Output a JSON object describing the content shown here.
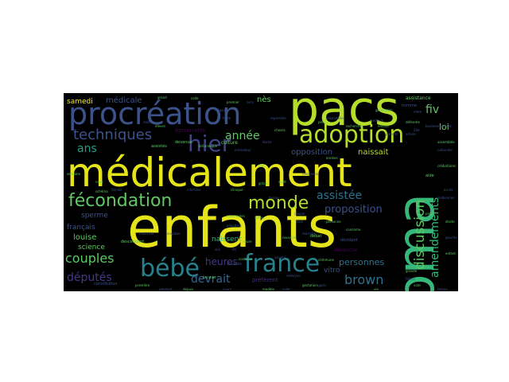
{
  "words": [
    {
      "text": "enfants",
      "weight": 1.0,
      "color": "#e5e419"
    },
    {
      "text": "médicalement",
      "weight": 0.9,
      "color": "#e5e419"
    },
    {
      "text": "pacs",
      "weight": 0.78,
      "color": "#b5de2b"
    },
    {
      "text": "pma",
      "weight": 0.78,
      "color": "#35b779"
    },
    {
      "text": "procréation",
      "weight": 0.55,
      "color": "#3b528b"
    },
    {
      "text": "adoption",
      "weight": 0.42,
      "color": "#b5de2b"
    },
    {
      "text": "france",
      "weight": 0.42,
      "color": "#26828e"
    },
    {
      "text": "bébé",
      "weight": 0.42,
      "color": "#26828e"
    },
    {
      "text": "fécondation",
      "weight": 0.34,
      "color": "#5ec962"
    },
    {
      "text": "monde",
      "weight": 0.34,
      "color": "#b5de2b"
    },
    {
      "text": "hier",
      "weight": 0.4,
      "color": "#414487"
    },
    {
      "text": "techniques",
      "weight": 0.3,
      "color": "#3b528b"
    },
    {
      "text": "discussion",
      "weight": 0.28,
      "color": "#5ec962"
    },
    {
      "text": "amendements",
      "weight": 0.22,
      "color": "#35b779"
    },
    {
      "text": "couples",
      "weight": 0.24,
      "color": "#5ec962"
    },
    {
      "text": "brown",
      "weight": 0.24,
      "color": "#2c728e"
    },
    {
      "text": "devrait",
      "weight": 0.22,
      "color": "#31688e"
    },
    {
      "text": "députés",
      "weight": 0.22,
      "color": "#443983"
    },
    {
      "text": "assistée",
      "weight": 0.22,
      "color": "#2c728e"
    },
    {
      "text": "proposition",
      "weight": 0.2,
      "color": "#3b528b"
    },
    {
      "text": "année",
      "weight": 0.2,
      "color": "#5ec962"
    },
    {
      "text": "ans",
      "weight": 0.2,
      "color": "#1f9e89"
    },
    {
      "text": "fiv",
      "weight": 0.2,
      "color": "#5ec962"
    },
    {
      "text": "heures",
      "weight": 0.18,
      "color": "#443983"
    },
    {
      "text": "loi",
      "weight": 0.14,
      "color": "#6ece58"
    },
    {
      "text": "personnes",
      "weight": 0.14,
      "color": "#2c728e"
    },
    {
      "text": "naissait",
      "weight": 0.13,
      "color": "#b5de2b"
    },
    {
      "text": "opposition",
      "weight": 0.13,
      "color": "#3b528b"
    },
    {
      "text": "médicale",
      "weight": 0.13,
      "color": "#3b528b"
    },
    {
      "text": "samedi",
      "weight": 0.12,
      "color": "#fde725"
    },
    {
      "text": "nès",
      "weight": 0.14,
      "color": "#5ec962"
    },
    {
      "text": "louise",
      "weight": 0.13,
      "color": "#5ec962"
    },
    {
      "text": "français",
      "weight": 0.12,
      "color": "#3b528b"
    },
    {
      "text": "science",
      "weight": 0.11,
      "color": "#5ec962"
    },
    {
      "text": "sperme",
      "weight": 0.11,
      "color": "#3b528b"
    },
    {
      "text": "naissent",
      "weight": 0.11,
      "color": "#35b779"
    },
    {
      "text": "vitro",
      "weight": 0.11,
      "color": "#3b528b"
    },
    {
      "text": "éprouvette",
      "weight": 0.08,
      "color": "#440154"
    },
    {
      "text": "préfèrent",
      "weight": 0.08,
      "color": "#472d7b"
    },
    {
      "text": "culture",
      "weight": 0.06,
      "color": "#5ec962"
    },
    {
      "text": "assistance",
      "weight": 0.06,
      "color": "#5ec962"
    },
    {
      "text": "dimanche",
      "weight": 0.06,
      "color": "#440154"
    },
    {
      "text": "décidant",
      "weight": 0.05,
      "color": "#3b528b"
    },
    {
      "text": "descendant",
      "weight": 0.05,
      "color": "#5ec962"
    },
    {
      "text": "inscrire",
      "weight": 0.05,
      "color": "#3b528b"
    },
    {
      "text": "devenue",
      "weight": 0.05,
      "color": "#5ec962"
    },
    {
      "text": "constitution",
      "weight": 0.04,
      "color": "#3b528b"
    },
    {
      "text": "aide",
      "weight": 0.05,
      "color": "#5ec962"
    },
    {
      "text": "débat",
      "weight": 0.04,
      "color": "#5ec962"
    },
    {
      "text": "homme",
      "weight": 0.04,
      "color": "#3b528b"
    },
    {
      "text": "grande",
      "weight": 0.04,
      "color": "#5ec962"
    },
    {
      "text": "grand",
      "weight": 0.04,
      "color": "#5ec962"
    },
    {
      "text": "continue",
      "weight": 0.04,
      "color": "#5ec962"
    },
    {
      "text": "fin",
      "weight": 0.04,
      "color": "#3b528b"
    },
    {
      "text": "concernées",
      "weight": 0.04,
      "color": "#5ec962"
    },
    {
      "text": "demandé",
      "weight": 0.04,
      "color": "#3b528b"
    },
    {
      "text": "assistés",
      "weight": 0.05,
      "color": "#5ec962"
    },
    {
      "text": "article",
      "weight": 0.04,
      "color": "#3b528b"
    },
    {
      "text": "défendre",
      "weight": 0.04,
      "color": "#5ec962"
    },
    {
      "text": "appris",
      "weight": 0.04,
      "color": "#3b528b"
    },
    {
      "text": "génération",
      "weight": 0.04,
      "color": "#5ec962"
    },
    {
      "text": "bouleversement",
      "weight": 0.04,
      "color": "#3b528b"
    },
    {
      "text": "concerne",
      "weight": 0.04,
      "color": "#5ec962"
    },
    {
      "text": "baisse",
      "weight": 0.04,
      "color": "#3b528b"
    },
    {
      "text": "heure",
      "weight": 0.04,
      "color": "#5ec962"
    },
    {
      "text": "fabius",
      "weight": 0.03,
      "color": "#3b528b"
    },
    {
      "text": "choses",
      "weight": 0.03,
      "color": "#5ec962"
    },
    {
      "text": "rapport",
      "weight": 0.03,
      "color": "#3b528b"
    },
    {
      "text": "600",
      "weight": 0.03,
      "color": "#5ec962"
    },
    {
      "text": "20e",
      "weight": 0.03,
      "color": "#3b528b"
    },
    {
      "text": "personne",
      "weight": 0.03,
      "color": "#5ec962"
    },
    {
      "text": "couple",
      "weight": 0.03,
      "color": "#3b528b"
    },
    {
      "text": "auteur",
      "weight": 0.03,
      "color": "#5ec962"
    },
    {
      "text": "société",
      "weight": 0.03,
      "color": "#3b528b"
    },
    {
      "text": "projet",
      "weight": 0.03,
      "color": "#5ec962"
    },
    {
      "text": "loin",
      "weight": 0.03,
      "color": "#3b528b"
    },
    {
      "text": "grâce",
      "weight": 0.03,
      "color": "#5ec962"
    },
    {
      "text": "droit",
      "weight": 0.03,
      "color": "#3b528b"
    },
    {
      "text": "commune",
      "weight": 0.03,
      "color": "#5ec962"
    },
    {
      "text": "anglaise",
      "weight": 0.03,
      "color": "#3b528b"
    },
    {
      "text": "clinique",
      "weight": 0.03,
      "color": "#5ec962"
    },
    {
      "text": "reprendre",
      "weight": 0.03,
      "color": "#3b528b"
    },
    {
      "text": "schéma",
      "weight": 0.03,
      "color": "#5ec962"
    },
    {
      "text": "famille",
      "weight": 0.03,
      "color": "#3b528b"
    },
    {
      "text": "ceux",
      "weight": 0.03,
      "color": "#5ec962"
    },
    {
      "text": "texte",
      "weight": 0.03,
      "color": "#3b528b"
    },
    {
      "text": "celle",
      "weight": 0.03,
      "color": "#5ec962"
    },
    {
      "text": "sera",
      "weight": 0.03,
      "color": "#3b528b"
    },
    {
      "text": "premier",
      "weight": 0.03,
      "color": "#5ec962"
    },
    {
      "text": "matin",
      "weight": 0.03,
      "color": "#3b528b"
    },
    {
      "text": "élèves",
      "weight": 0.03,
      "color": "#5ec962"
    },
    {
      "text": "durée",
      "weight": 0.03,
      "color": "#3b528b"
    },
    {
      "text": "sujet",
      "weight": 0.03,
      "color": "#5ec962"
    },
    {
      "text": "mariage",
      "weight": 0.03,
      "color": "#3b528b"
    },
    {
      "text": "nouvelle",
      "weight": 0.03,
      "color": "#5ec962"
    },
    {
      "text": "président",
      "weight": 0.03,
      "color": "#3b528b"
    },
    {
      "text": "vote",
      "weight": 0.03,
      "color": "#5ec962"
    },
    {
      "text": "mère",
      "weight": 0.03,
      "color": "#3b528b"
    },
    {
      "text": "père",
      "weight": 0.03,
      "color": "#5ec962"
    },
    {
      "text": "laboratoire",
      "weight": 0.03,
      "color": "#3b528b"
    },
    {
      "text": "recherche",
      "weight": 0.03,
      "color": "#5ec962"
    },
    {
      "text": "médecin",
      "weight": 0.03,
      "color": "#3b528b"
    },
    {
      "text": "encore",
      "weight": 0.03,
      "color": "#5ec962"
    },
    {
      "text": "parents",
      "weight": 0.03,
      "color": "#3b528b"
    },
    {
      "text": "années",
      "weight": 0.03,
      "color": "#5ec962"
    },
    {
      "text": "naissance",
      "weight": 0.03,
      "color": "#3b528b"
    },
    {
      "text": "femmes",
      "weight": 0.03,
      "color": "#5ec962"
    },
    {
      "text": "embryon",
      "weight": 0.03,
      "color": "#3b528b"
    },
    {
      "text": "gestation",
      "weight": 0.03,
      "color": "#5ec962"
    },
    {
      "text": "infertiles",
      "weight": 0.03,
      "color": "#3b528b"
    },
    {
      "text": "britannique",
      "weight": 0.03,
      "color": "#5ec962"
    },
    {
      "text": "ordinateur",
      "weight": 0.03,
      "color": "#3b528b"
    },
    {
      "text": "première",
      "weight": 0.03,
      "color": "#5ec962"
    },
    {
      "text": "pendant",
      "weight": 0.03,
      "color": "#3b528b"
    },
    {
      "text": "depuis",
      "weight": 0.03,
      "color": "#5ec962"
    },
    {
      "text": "cours",
      "weight": 0.03,
      "color": "#3b528b"
    },
    {
      "text": "modèle",
      "weight": 0.03,
      "color": "#5ec962"
    },
    {
      "text": "suite",
      "weight": 0.03,
      "color": "#3b528b"
    },
    {
      "text": "vie",
      "weight": 0.03,
      "color": "#5ec962"
    },
    {
      "text": "temps",
      "weight": 0.03,
      "color": "#3b528b"
    },
    {
      "text": "enfant",
      "weight": 0.03,
      "color": "#5ec962"
    },
    {
      "text": "accès",
      "weight": 0.03,
      "color": "#3b528b"
    },
    {
      "text": "célibataires",
      "weight": 0.03,
      "color": "#5ec962"
    },
    {
      "text": "lesbiennes",
      "weight": 0.03,
      "color": "#3b528b"
    },
    {
      "text": "droite",
      "weight": 0.03,
      "color": "#5ec962"
    },
    {
      "text": "gauche",
      "weight": 0.03,
      "color": "#3b528b"
    },
    {
      "text": "assemblée",
      "weight": 0.03,
      "color": "#5ec962"
    },
    {
      "text": "nationale",
      "weight": 0.03,
      "color": "#3b528b"
    },
    {
      "text": "semaine",
      "weight": 0.03,
      "color": "#5ec962"
    }
  ]
}
